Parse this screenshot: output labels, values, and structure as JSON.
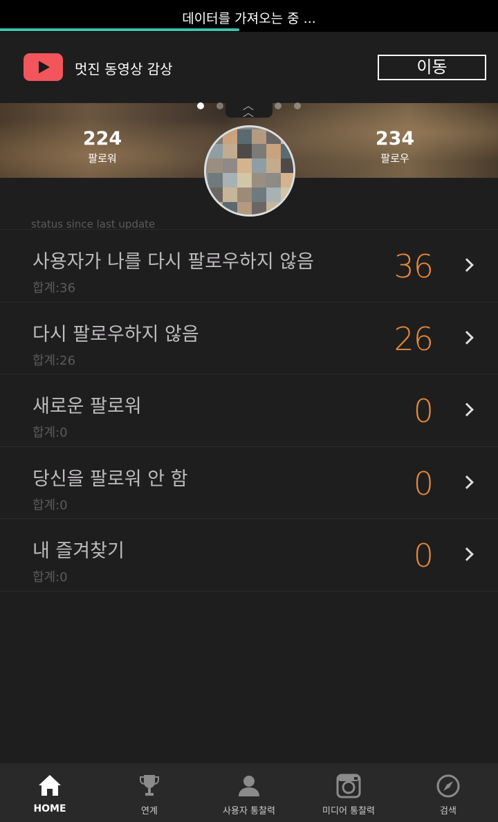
{
  "status_bar": {
    "loading_text": "데이터를 가져오는 중 ...",
    "progress": 0.48,
    "accent": "#3fbfad"
  },
  "promo": {
    "text": "멋진 동영상 감상",
    "button": "이동",
    "icon": "youtube-play-icon"
  },
  "profile": {
    "followers_count": "224",
    "followers_label": "팔로워",
    "following_count": "234",
    "following_label": "팔로우"
  },
  "list": {
    "header": "status since last update",
    "items": [
      {
        "title": "사용자가 나를 다시 팔로우하지 않음",
        "total": "합계:36",
        "count": "36"
      },
      {
        "title": "다시 팔로우하지 않음",
        "total": "합계:26",
        "count": "26"
      },
      {
        "title": "새로운 팔로워",
        "total": "합계:0",
        "count": "0"
      },
      {
        "title": "당신을 팔로워 안 함",
        "total": "합계:0",
        "count": "0"
      },
      {
        "title": "내 즐겨찾기",
        "total": "합계:0",
        "count": "0"
      }
    ]
  },
  "nav": {
    "items": [
      {
        "label": "HOME",
        "icon": "home-icon"
      },
      {
        "label": "연계",
        "icon": "trophy-icon"
      },
      {
        "label": "사용자 통찰력",
        "icon": "user-icon"
      },
      {
        "label": "미디어 통찰력",
        "icon": "instagram-icon"
      },
      {
        "label": "검색",
        "icon": "compass-icon"
      }
    ]
  }
}
